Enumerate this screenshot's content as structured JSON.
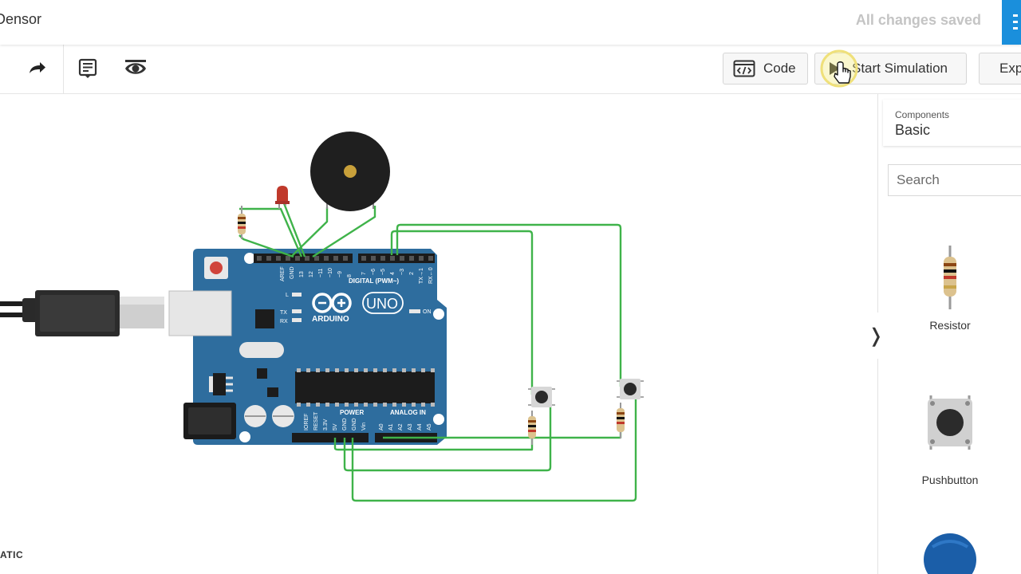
{
  "header": {
    "project_title": "Densor",
    "save_status": "All changes saved"
  },
  "toolbar": {
    "code_label": "Code",
    "simulate_label": "Start Simulation",
    "export_label": "Exp"
  },
  "canvas": {
    "corner_text": "ATIC",
    "arduino": {
      "logo": "ARDUINO",
      "model": "UNO",
      "digital_label": "DIGITAL (PWM~)",
      "power_label": "POWER",
      "analog_label": "ANALOG IN",
      "aref": "AREF",
      "gnd": "GND",
      "pin_13": "13",
      "pin_12": "12",
      "pin_11": "~11",
      "pin_10": "~10",
      "pin_9": "~9",
      "pin_8": "8",
      "pin_7": "7",
      "pin_6": "~6",
      "pin_5": "~5",
      "pin_4": "4",
      "pin_3": "~3",
      "pin_2": "2",
      "pin_tx": "TX→1",
      "pin_rx": "RX←0",
      "led_l": "L",
      "led_tx": "TX",
      "led_rx": "RX",
      "led_on": "ON",
      "ioref": "IOREF",
      "reset": "RESET",
      "v33": "3.3V",
      "v5": "5V",
      "vin": "Vin",
      "a0": "A0",
      "a1": "A1",
      "a2": "A2",
      "a3": "A3",
      "a4": "A4",
      "a5": "A5"
    }
  },
  "panel": {
    "components_label": "Components",
    "components_type": "Basic",
    "search_placeholder": "Search",
    "items": [
      {
        "name": "Resistor",
        "icon": "resistor-icon"
      },
      {
        "name": "Pushbutton",
        "icon": "pushbutton-icon"
      },
      {
        "name": "",
        "icon": "potentiometer-icon"
      }
    ]
  },
  "colors": {
    "board": "#2e6d9e",
    "wire": "#3fb34a",
    "accent_blue": "#1a8fdc",
    "led": "#c0392b",
    "buzzer": "#1f1f1f"
  }
}
